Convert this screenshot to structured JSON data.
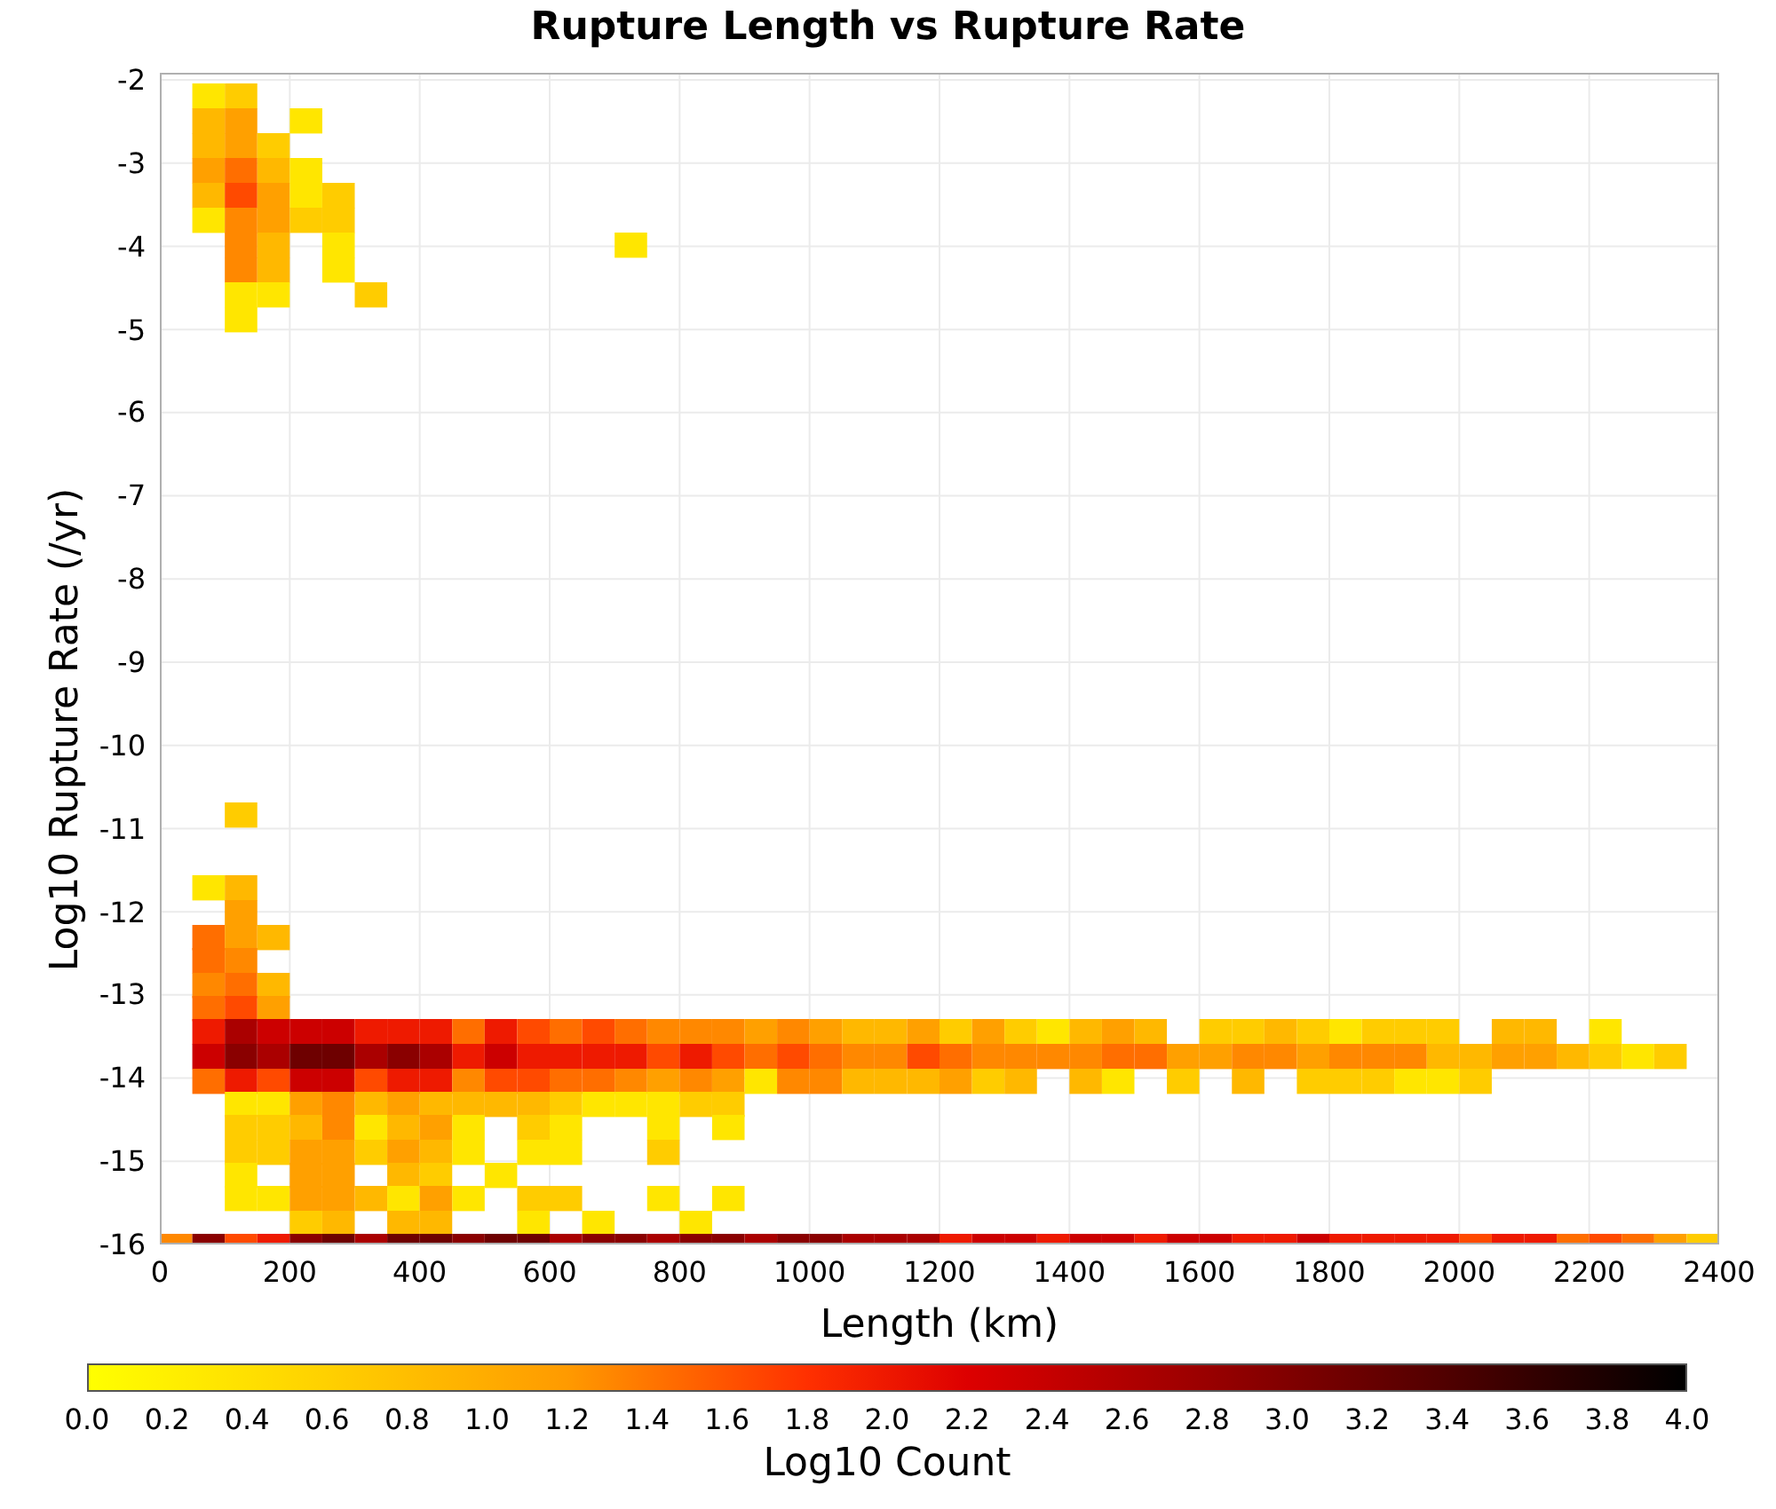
{
  "chart": {
    "title": "Rupture Length vs Rupture Rate",
    "y_axis": {
      "label": "Log10 Rupture Rate (/yr)",
      "ticks": [
        "-2",
        "-3",
        "-4",
        "-5",
        "-6",
        "-7",
        "-8",
        "-9",
        "-10",
        "-11",
        "-12",
        "-13",
        "-14",
        "-15",
        "-16"
      ]
    },
    "x_axis": {
      "label": "Length (km)",
      "ticks": [
        "0",
        "200",
        "400",
        "600",
        "800",
        "1000",
        "1200",
        "1400",
        "1600",
        "1800",
        "2000",
        "2200",
        "2400"
      ]
    },
    "color_scale": {
      "label": "Log10 Count",
      "ticks": [
        "0.0",
        "0.2",
        "0.4",
        "0.6",
        "0.8",
        "1.0",
        "1.2",
        "1.4",
        "1.6",
        "1.8",
        "2.0",
        "2.2",
        "2.4",
        "2.6",
        "2.8",
        "3.0",
        "3.2",
        "3.4",
        "3.6",
        "3.8",
        "4.0"
      ]
    }
  }
}
